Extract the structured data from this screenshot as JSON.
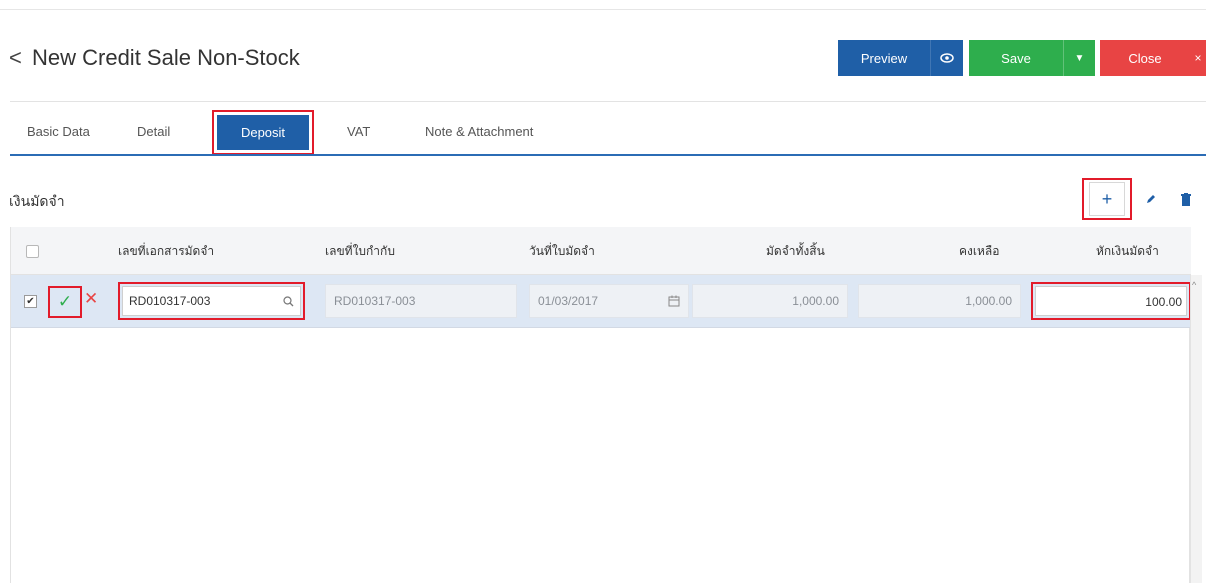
{
  "header": {
    "back_glyph": "<",
    "title": "New Credit Sale Non-Stock",
    "preview_label": "Preview",
    "save_label": "Save",
    "close_label": "Close"
  },
  "tabs": [
    {
      "label": "Basic Data"
    },
    {
      "label": "Detail"
    },
    {
      "label": "Deposit"
    },
    {
      "label": "VAT"
    },
    {
      "label": "Note & Attachment"
    }
  ],
  "section": {
    "title": "เงินมัดจำ"
  },
  "table": {
    "columns": [
      "เลขที่เอกสารมัดจำ",
      "เลขที่ใบกำกับ",
      "วันที่ใบมัดจำ",
      "มัดจำทั้งสิ้น",
      "คงเหลือ",
      "หักเงินมัดจำ"
    ],
    "rows": [
      {
        "doc_no": "RD010317-003",
        "tax_invoice_no": "RD010317-003",
        "date": "01/03/2017",
        "total": "1,000.00",
        "remaining": "1,000.00",
        "deduct": "100.00"
      }
    ]
  },
  "icons": {
    "preview": "eye-icon",
    "save_menu": "caret-down-icon",
    "close": "close-icon",
    "add": "plus-icon",
    "edit": "pencil-icon",
    "delete": "trash-icon",
    "search": "search-icon",
    "calendar": "calendar-icon"
  },
  "colors": {
    "primary": "#1f5fa7",
    "success": "#2eae4d",
    "danger": "#e84444",
    "highlight": "#e21b2a"
  }
}
